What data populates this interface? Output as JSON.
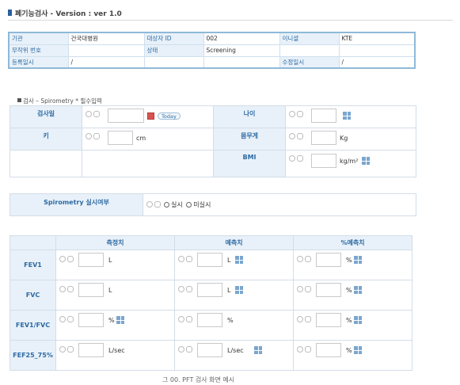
{
  "page": {
    "title": "폐기능검사 - Version : ver 1.0"
  },
  "info": {
    "rows": [
      [
        {
          "label": "기관",
          "value": "건국대병원"
        },
        {
          "label": "대상자 ID",
          "value": "002"
        },
        {
          "label": "이니셜",
          "value": "KTE"
        }
      ],
      [
        {
          "label": "무작위 번호",
          "value": ""
        },
        {
          "label": "상태",
          "value": "Screening"
        },
        {
          "label": "",
          "value": ""
        }
      ],
      [
        {
          "label": "등록일시",
          "value": "/"
        },
        {
          "label": "",
          "value": ""
        },
        {
          "label": "수정일시",
          "value": "/"
        }
      ]
    ]
  },
  "section": {
    "title": "검사 – Spirometry * 필수입력"
  },
  "basic": {
    "exam_date_label": "검사일",
    "today_label": "Today",
    "age_label": "나이",
    "height_label": "키",
    "height_unit": "cm",
    "weight_label": "몸무게",
    "weight_unit": "Kg",
    "bmi_label": "BMI",
    "bmi_unit": "kg/m²"
  },
  "done": {
    "label": "Spirometry 실시여부",
    "opt_yes": "실시",
    "opt_no": "미실시"
  },
  "measure": {
    "headers": [
      "측정치",
      "예측치",
      "%예측치"
    ],
    "rows": [
      {
        "name": "FEV1",
        "u1": "L",
        "u2": "L",
        "u3": "%"
      },
      {
        "name": "FVC",
        "u1": "L",
        "u2": "L",
        "u3": "%"
      },
      {
        "name": "FEV1/FVC",
        "u1": "%",
        "u2": "%",
        "u3": "%"
      },
      {
        "name": "FEF25_75%",
        "u1": "L/sec",
        "u2": "L/sec",
        "u3": "%"
      }
    ]
  },
  "caption": "그 00. PFT 검사 화면 예시"
}
